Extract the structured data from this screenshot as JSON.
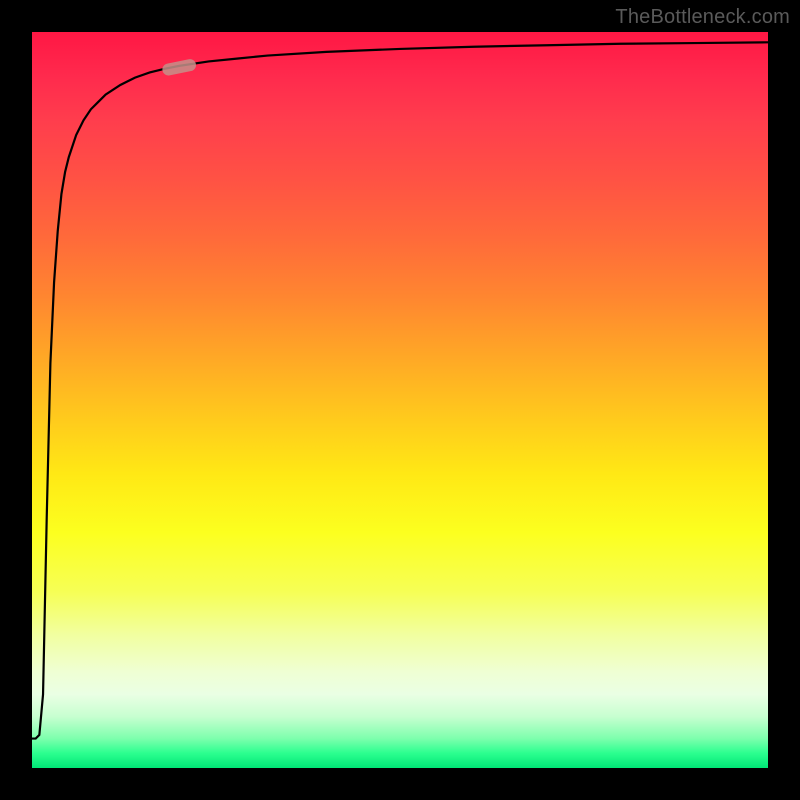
{
  "watermark": "TheBottleneck.com",
  "chart_data": {
    "type": "line",
    "title": "",
    "xlabel": "",
    "ylabel": "",
    "xlim": [
      0,
      100
    ],
    "ylim": [
      0,
      100
    ],
    "grid": false,
    "legend": false,
    "series": [
      {
        "name": "bottleneck-curve",
        "color": "#000000",
        "x": [
          0.0,
          0.5,
          1.0,
          1.5,
          2.0,
          2.5,
          3.0,
          3.5,
          4.0,
          4.5,
          5.0,
          6.0,
          7.0,
          8.0,
          9.0,
          10.0,
          12.0,
          14.0,
          16.0,
          18.0,
          20.0,
          24.0,
          28.0,
          32.0,
          40.0,
          50.0,
          60.0,
          70.0,
          80.0,
          90.0,
          100.0
        ],
        "y": [
          4.0,
          4.0,
          4.5,
          10.0,
          34.0,
          55.0,
          66.0,
          73.0,
          78.0,
          81.0,
          83.0,
          86.0,
          88.0,
          89.5,
          90.5,
          91.5,
          92.8,
          93.8,
          94.5,
          95.0,
          95.4,
          96.0,
          96.4,
          96.8,
          97.3,
          97.7,
          98.0,
          98.2,
          98.4,
          98.5,
          98.6
        ]
      }
    ],
    "marker": {
      "x": 20.0,
      "y": 95.2,
      "color": "#c49089",
      "shape": "pill"
    },
    "background_gradient": {
      "top": "#ff1744",
      "middle": "#ffee00",
      "bottom": "#00e676"
    }
  }
}
